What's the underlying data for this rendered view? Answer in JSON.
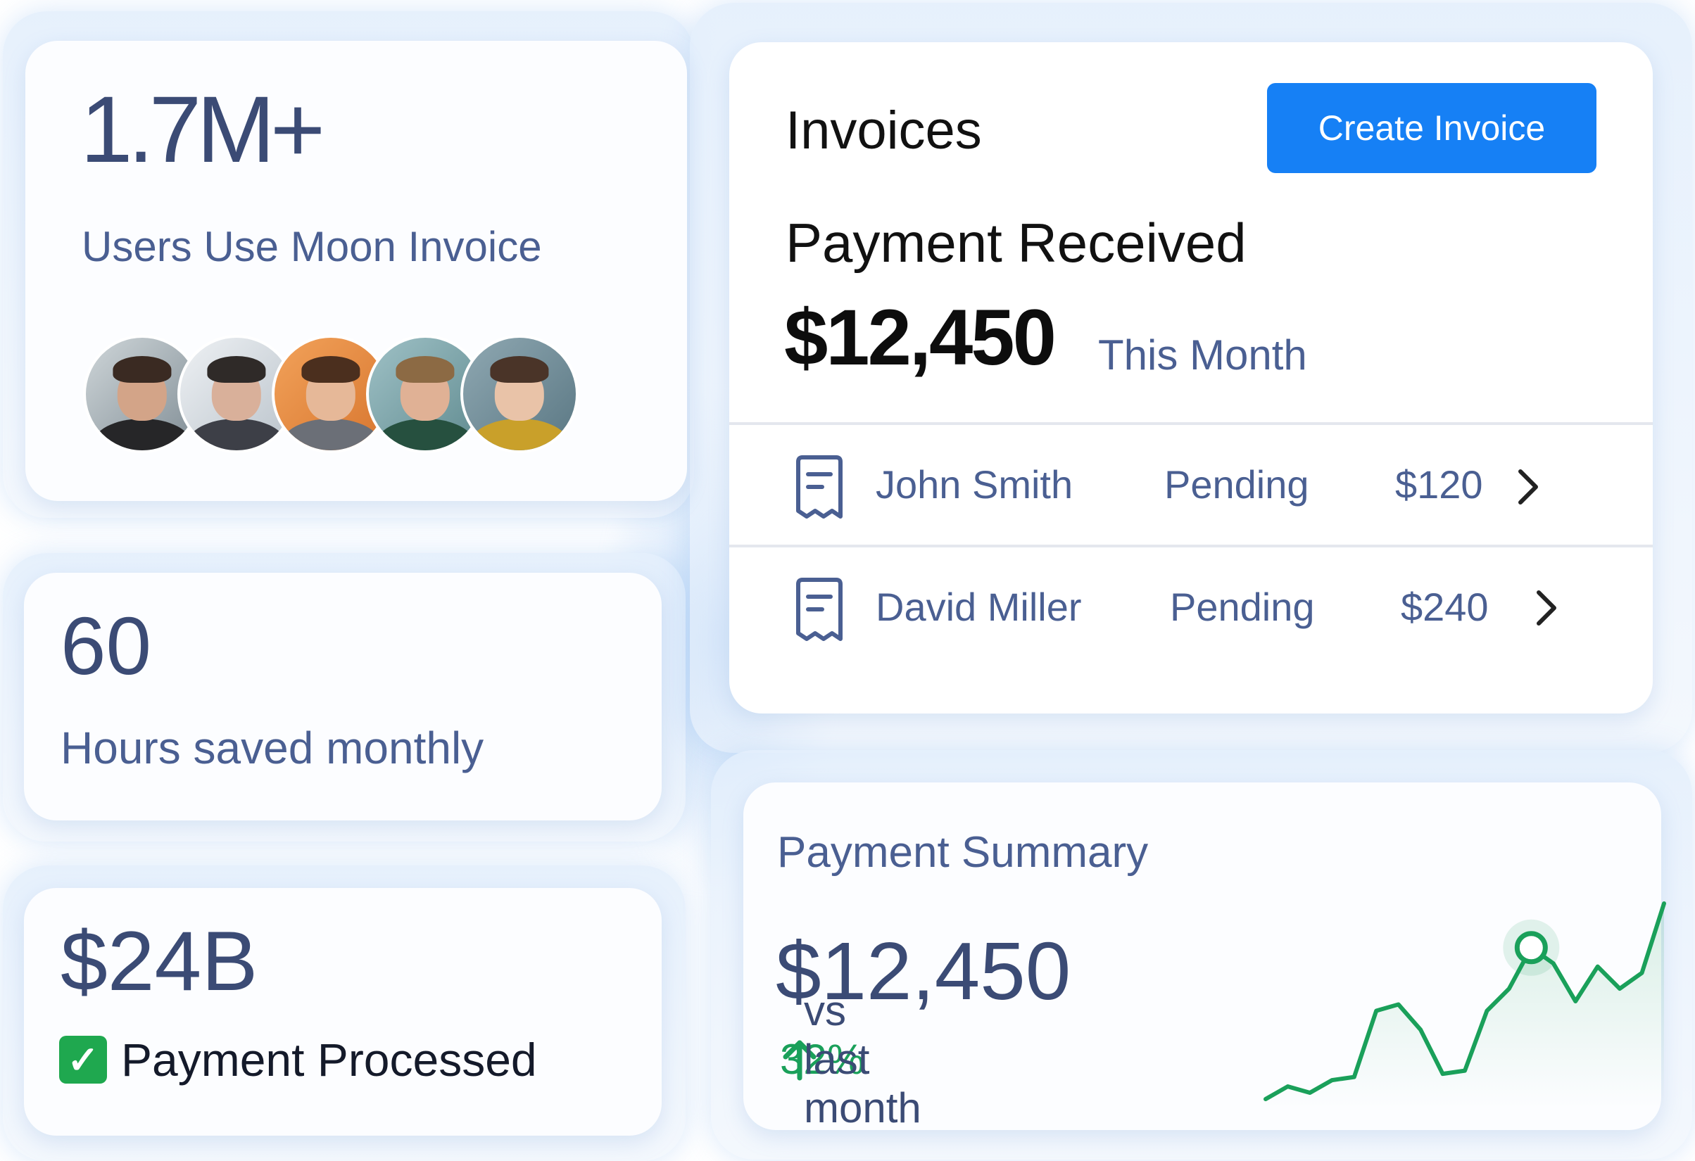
{
  "users_card": {
    "stat": "1.7M+",
    "label": "Users Use Moon Invoice",
    "avatars": [
      {
        "name": "user-avatar-1"
      },
      {
        "name": "user-avatar-2"
      },
      {
        "name": "user-avatar-3"
      },
      {
        "name": "user-avatar-4"
      },
      {
        "name": "user-avatar-5"
      }
    ]
  },
  "hours_card": {
    "stat": "60",
    "label": "Hours saved monthly"
  },
  "processed_card": {
    "stat": "$24B",
    "check_icon": "✅",
    "label": "Payment Processed"
  },
  "invoices_card": {
    "title": "Invoices",
    "create_button": "Create Invoice",
    "payment_label": "Payment Received",
    "amount": "$12,450",
    "period": "This Month",
    "rows": [
      {
        "name": "John Smith",
        "status": "Pending",
        "amount": "$120",
        "icon": "receipt-icon"
      },
      {
        "name": "David Miller",
        "status": "Pending",
        "amount": "$240",
        "icon": "receipt-icon"
      }
    ]
  },
  "summary_card": {
    "title": "Payment Summary",
    "amount": "$12,450",
    "trend_icon": "arrow-up-icon",
    "change": "32%",
    "comparison": "vs last month"
  },
  "colors": {
    "navy": "#3b4b75",
    "slate": "#4a5f92",
    "primary": "#1680f5",
    "positive": "#1aa05a"
  },
  "chart_data": {
    "type": "line",
    "series": [
      {
        "values": [
          2,
          6,
          4,
          8,
          9,
          30,
          32,
          24,
          10,
          11,
          30,
          37,
          50,
          45,
          33,
          44,
          37,
          42,
          64
        ]
      }
    ],
    "highlighted_index": 12
  }
}
